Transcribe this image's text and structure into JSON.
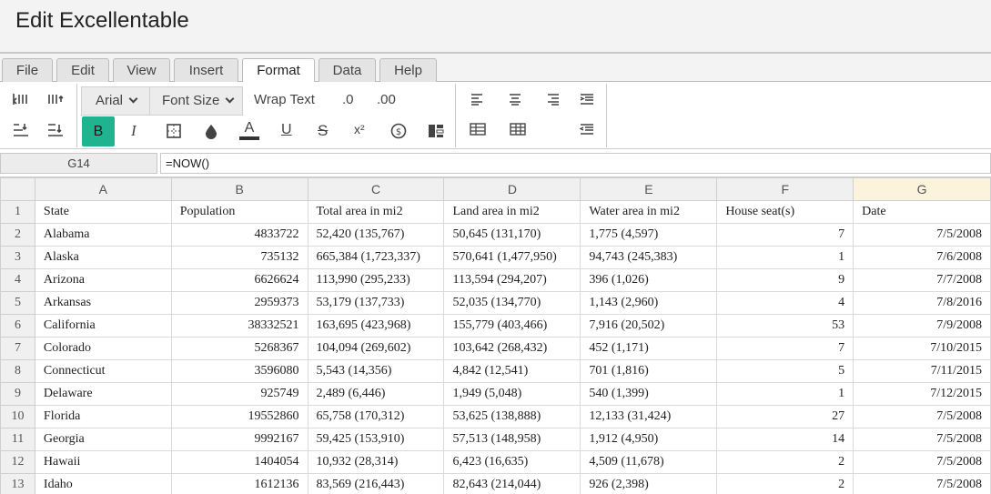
{
  "app": {
    "title": "Edit Excellentable"
  },
  "menu": {
    "tabs": [
      {
        "label": "File"
      },
      {
        "label": "Edit"
      },
      {
        "label": "View"
      },
      {
        "label": "Insert"
      },
      {
        "label": "Format"
      },
      {
        "label": "Data"
      },
      {
        "label": "Help"
      }
    ],
    "active": "Format"
  },
  "toolbar": {
    "font_family": "Arial",
    "font_size": "Font Size",
    "wrap_text": "Wrap Text",
    "decrease_decimal": ".0",
    "increase_decimal": ".00",
    "bold": "B",
    "italic": "I",
    "font_color_glyph": "A",
    "underline_glyph": "U",
    "strike_glyph": "S",
    "superscript_glyph": "x²",
    "accent_color": "#1fb48f",
    "icons": [
      "column-width-icon",
      "row-height-icon",
      "indent-icon",
      "outdent-icon",
      "border-icon",
      "fill-color-icon",
      "currency-icon",
      "conditional-format-icon",
      "align-left-icon",
      "align-center-icon",
      "align-right-icon",
      "align-justify-icon",
      "table-icon",
      "grid-icon",
      "wrap-indent-icon"
    ]
  },
  "formula_bar": {
    "cell_ref": "G14",
    "formula": "=NOW()"
  },
  "sheet": {
    "columns": [
      "A",
      "B",
      "C",
      "D",
      "E",
      "F",
      "G"
    ],
    "selected_column": "G",
    "rows": [
      {
        "n": "1",
        "cells": [
          "State",
          "Population",
          "Total area in mi2",
          "Land area in mi2",
          "Water area in mi2",
          "House seat(s)",
          "Date"
        ]
      },
      {
        "n": "2",
        "cells": [
          "Alabama",
          "4833722",
          "52,420 (135,767)",
          "50,645 (131,170)",
          "1,775 (4,597)",
          "7",
          "7/5/2008"
        ]
      },
      {
        "n": "3",
        "cells": [
          "Alaska",
          "735132",
          "665,384 (1,723,337)",
          "570,641 (1,477,950)",
          "94,743 (245,383)",
          "1",
          "7/6/2008"
        ]
      },
      {
        "n": "4",
        "cells": [
          "Arizona",
          "6626624",
          "113,990 (295,233)",
          "113,594 (294,207)",
          "396 (1,026)",
          "9",
          "7/7/2008"
        ]
      },
      {
        "n": "5",
        "cells": [
          "Arkansas",
          "2959373",
          "53,179 (137,733)",
          "52,035 (134,770)",
          "1,143 (2,960)",
          "4",
          "7/8/2016"
        ]
      },
      {
        "n": "6",
        "cells": [
          "California",
          "38332521",
          "163,695 (423,968)",
          "155,779 (403,466)",
          "7,916 (20,502)",
          "53",
          "7/9/2008"
        ]
      },
      {
        "n": "7",
        "cells": [
          "Colorado",
          "5268367",
          "104,094 (269,602)",
          "103,642 (268,432)",
          "452 (1,171)",
          "7",
          "7/10/2015"
        ]
      },
      {
        "n": "8",
        "cells": [
          "Connecticut",
          "3596080",
          "5,543 (14,356)",
          "4,842 (12,541)",
          "701 (1,816)",
          "5",
          "7/11/2015"
        ]
      },
      {
        "n": "9",
        "cells": [
          "Delaware",
          "925749",
          "2,489 (6,446)",
          "1,949 (5,048)",
          "540 (1,399)",
          "1",
          "7/12/2015"
        ]
      },
      {
        "n": "10",
        "cells": [
          "Florida",
          "19552860",
          "65,758 (170,312)",
          "53,625 (138,888)",
          "12,133 (31,424)",
          "27",
          "7/5/2008"
        ]
      },
      {
        "n": "11",
        "cells": [
          "Georgia",
          "9992167",
          "59,425 (153,910)",
          "57,513 (148,958)",
          "1,912 (4,950)",
          "14",
          "7/5/2008"
        ]
      },
      {
        "n": "12",
        "cells": [
          "Hawaii",
          "1404054",
          "10,932 (28,314)",
          "6,423 (16,635)",
          "4,509 (11,678)",
          "2",
          "7/5/2008"
        ]
      },
      {
        "n": "13",
        "cells": [
          "Idaho",
          "1612136",
          "83,569 (216,443)",
          "82,643 (214,044)",
          "926 (2,398)",
          "2",
          "7/5/2008"
        ]
      }
    ]
  }
}
